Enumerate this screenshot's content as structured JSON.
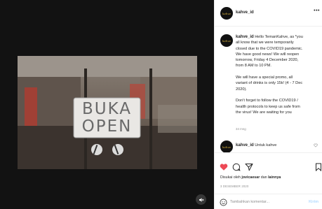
{
  "account": {
    "username": "kahve_id",
    "avatar_text": "kahve"
  },
  "post": {
    "sign_line1": "BUKA",
    "sign_line2": "OPEN",
    "caption_lines": [
      "Hello TemanKahve, as *you",
      "all know that we were temporarily",
      "closed due to the COVID19 pandemic.",
      "We have good news! We will reopen",
      "tomorrow, Friday 4 December 2020,",
      "from 8 AM to 10 PM.",
      "",
      "We will have a special promo, all",
      "variant of drinks is only 15k! (4 - 7 Dec",
      "2020).",
      "",
      "Don't forget to follow the COVID19 /",
      "health protocols to keep us safe from",
      "the virus! We are waiting for you"
    ],
    "time_ago": "34 mng",
    "comment": {
      "username": "kahve_id",
      "text": "Untuk kahve"
    },
    "liked_by": {
      "prefix": "Disukai oleh",
      "user": "jovicaesar",
      "conj": "dan",
      "others": "lainnya"
    },
    "date": "3 DESEMBER 2020",
    "comment_placeholder": "Tambahkan komentar...",
    "post_label": "Kirim"
  },
  "colors": {
    "like_red": "#ed4956",
    "post_disabled": "#b3dbff",
    "media_bg": "#121212"
  },
  "icons": [
    "more-icon",
    "heart-icon",
    "comment-icon",
    "share-icon",
    "save-icon",
    "emoji-icon",
    "mute-icon"
  ]
}
